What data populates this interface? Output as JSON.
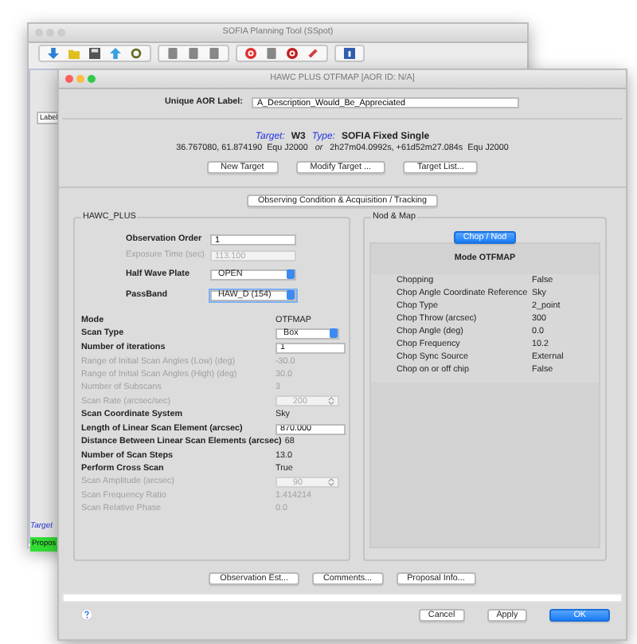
{
  "background_window": {
    "title": "SOFIA Planning Tool (SSpot)",
    "table_header": "Label",
    "target_label": "Target",
    "proposal_button": "Propos"
  },
  "dialog": {
    "title": "HAWC PLUS OTFMAP [AOR ID: N/A]",
    "aor_label": {
      "label": "Unique AOR Label:",
      "value": "A_Description_Would_Be_Appreciated"
    },
    "target": {
      "target_label": "Target:",
      "target_name": "W3",
      "type_label": "Type:",
      "type_value": "SOFIA Fixed Single",
      "coordinates": "36.767080, 61.874190  Equ J2000   *or*   2h27m04.0992s, +61d52m27.084s  Equ J2000"
    },
    "target_buttons": [
      "New Target",
      "Modify Target ...",
      "Target List..."
    ],
    "section_tab": "Observing Condition & Acquisition / Tracking",
    "instrument_group": {
      "title": "HAWC_PLUS",
      "top_rows": [
        {
          "label": "Observation Order",
          "kind": "field",
          "value": "1",
          "disabled": false,
          "focused": false
        },
        {
          "label": "Exposure Time (sec)",
          "kind": "field",
          "value": "113.100",
          "disabled": true,
          "focused": false
        },
        {
          "label": "Half Wave Plate",
          "kind": "select",
          "value": "OPEN",
          "disabled": false,
          "focused": false
        },
        {
          "label": "PassBand",
          "kind": "select",
          "value": "HAW_D (154)",
          "disabled": false,
          "focused": true
        }
      ],
      "scan_rows": [
        {
          "label": "Mode",
          "kind": "text",
          "value": "OTFMAP",
          "disabled": false
        },
        {
          "label": "Scan Type",
          "kind": "select",
          "value": "Box",
          "disabled": false
        },
        {
          "label": "Number of iterations",
          "kind": "field",
          "value": "1",
          "disabled": false
        },
        {
          "label": "Range of Initial Scan Angles (Low) (deg)",
          "kind": "text",
          "value": "-30.0",
          "disabled": true
        },
        {
          "label": "Range of Initial Scan Angles (High) (deg)",
          "kind": "text",
          "value": "30.0",
          "disabled": true
        },
        {
          "label": "Number of Subscans",
          "kind": "text",
          "value": "3",
          "disabled": true
        },
        {
          "label": "Scan Rate (arcsec/sec)",
          "kind": "spinner",
          "value": "200",
          "disabled": true
        },
        {
          "label": "Scan Coordinate System",
          "kind": "text",
          "value": "Sky",
          "disabled": false
        },
        {
          "label": "Length of Linear Scan Element (arcsec)",
          "kind": "field",
          "value": "870.000",
          "disabled": false
        },
        {
          "label": "Distance Between Linear Scan Elements (arcsec)",
          "kind": "text",
          "value": "68",
          "disabled": false
        },
        {
          "label": "Number of Scan Steps",
          "kind": "text",
          "value": "13.0",
          "disabled": false
        },
        {
          "label": "Perform Cross Scan",
          "kind": "text",
          "value": "True",
          "disabled": false
        },
        {
          "label": "Scan Amplitude (arcsec)",
          "kind": "spinner",
          "value": "90",
          "disabled": true
        },
        {
          "label": "Scan Frequency Ratio",
          "kind": "text",
          "value": "1.414214",
          "disabled": true
        },
        {
          "label": "Scan Relative Phase",
          "kind": "text",
          "value": "0.0",
          "disabled": true
        }
      ]
    },
    "nod_group": {
      "title": "Nod & Map",
      "tabs": [
        {
          "label": "Chop / Nod",
          "selected": true
        }
      ],
      "mode": "Mode OTFMAP",
      "rows": [
        {
          "label": "Chopping",
          "value": "False"
        },
        {
          "label": "Chop Angle Coordinate Reference",
          "value": "Sky"
        },
        {
          "label": "Chop Type",
          "value": "2_point"
        },
        {
          "label": "Chop Throw (arcsec)",
          "value": "300"
        },
        {
          "label": "Chop Angle (deg)",
          "value": "0.0"
        },
        {
          "label": "Chop Frequency",
          "value": "10.2"
        },
        {
          "label": "Chop Sync Source",
          "value": "External"
        },
        {
          "label": "Chop on or off chip",
          "value": "False"
        }
      ]
    },
    "action_buttons": [
      "Observation Est...",
      "Comments...",
      "Proposal Info..."
    ],
    "footer_buttons": [
      {
        "label": "Cancel",
        "default": false
      },
      {
        "label": "Apply",
        "default": false
      },
      {
        "label": "OK",
        "default": true
      }
    ]
  }
}
